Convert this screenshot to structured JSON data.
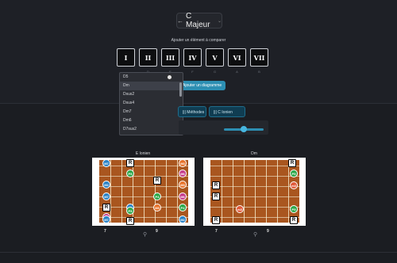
{
  "header": {
    "title": "C Majeur",
    "back_glyph": "←",
    "caret_glyph": "⌄"
  },
  "subtitle": "Ajouter un élément à comparer",
  "degrees": [
    {
      "label": "I",
      "sub": ""
    },
    {
      "label": "II",
      "sub": "D"
    },
    {
      "label": "III",
      "sub": "E"
    },
    {
      "label": "IV",
      "sub": "F"
    },
    {
      "label": "V",
      "sub": "G"
    },
    {
      "label": "VI",
      "sub": "A"
    },
    {
      "label": "VII",
      "sub": "B"
    }
  ],
  "dropdown": {
    "items": [
      "D5",
      "Dm",
      "Dsus2",
      "Dsus4",
      "Dm7",
      "Dm6",
      "D7sus2"
    ],
    "highlighted": 1
  },
  "add_button": "Ajouter un diagramme",
  "mode_buttons": [
    {
      "icon": "|||",
      "label": "Méthodes"
    },
    {
      "icon": "|||",
      "label": "C Ionien"
    }
  ],
  "boards": [
    {
      "label": "E Ionien",
      "fret_start": "7",
      "fret_end": "9",
      "notes": [
        {
          "label": "M7",
          "color": "#2a82c5",
          "root": false
        },
        {
          "label": "R",
          "color": "#ffffff",
          "root": true
        },
        {
          "label": "M3",
          "color": "#e7722a",
          "root": false
        },
        {
          "label": "P5",
          "color": "#2da84a",
          "root": false
        },
        {
          "label": "M6",
          "color": "#c63c8c",
          "root": false
        },
        {
          "label": "M2",
          "color": "#2a82c5",
          "root": false
        },
        {
          "label": "R",
          "color": "#ffffff",
          "root": true
        },
        {
          "label": "M3",
          "color": "#e7722a",
          "root": false
        },
        {
          "label": "M7",
          "color": "#2a82c5",
          "root": false
        },
        {
          "label": "P4",
          "color": "#2da84a",
          "root": false
        },
        {
          "label": "M6",
          "color": "#c63c8c",
          "root": false
        },
        {
          "label": "R",
          "color": "#ffffff",
          "root": true
        },
        {
          "label": "M2",
          "color": "#2a82c5",
          "root": false
        },
        {
          "label": "M3",
          "color": "#e7722a",
          "root": false
        },
        {
          "label": "P4",
          "color": "#2da84a",
          "root": false
        },
        {
          "label": "P5",
          "color": "#2da84a",
          "root": false
        },
        {
          "label": "M6",
          "color": "#c63c8c",
          "root": false
        },
        {
          "label": "M7",
          "color": "#2a82c5",
          "root": false
        },
        {
          "label": "R",
          "color": "#ffffff",
          "root": true
        },
        {
          "label": "M2",
          "color": "#2a82c5",
          "root": false
        }
      ]
    },
    {
      "label": "Dm",
      "fret_start": "7",
      "fret_end": "9",
      "notes": [
        {
          "label": "R",
          "color": "#ffffff",
          "root": true
        },
        {
          "label": "P5",
          "color": "#2da84a",
          "root": false
        },
        {
          "label": "m3",
          "color": "#e05a3a",
          "root": false
        },
        {
          "label": "R",
          "color": "#ffffff",
          "root": true
        },
        {
          "label": "R",
          "color": "#ffffff",
          "root": true
        },
        {
          "label": "m3",
          "color": "#e05a3a",
          "root": false
        },
        {
          "label": "P5",
          "color": "#2da84a",
          "root": false
        },
        {
          "label": "R",
          "color": "#ffffff",
          "root": true
        },
        {
          "label": "R",
          "color": "#ffffff",
          "root": true
        }
      ]
    }
  ],
  "icons": {
    "pin": "pin-icon",
    "cursor": "cursor-icon"
  }
}
